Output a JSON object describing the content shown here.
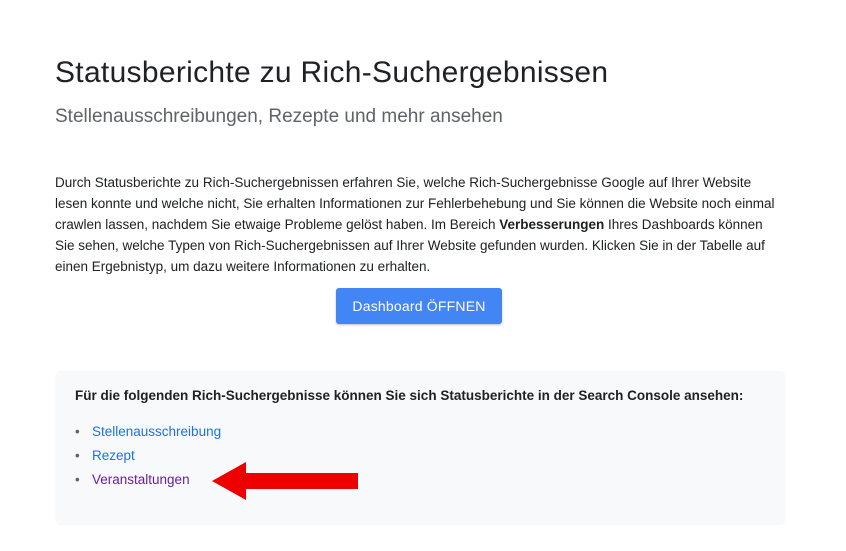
{
  "header": {
    "title": "Statusberichte zu Rich-Suchergebnissen",
    "subtitle": "Stellenausschreibungen, Rezepte und mehr ansehen"
  },
  "intro": {
    "text_before_bold": "Durch Statusberichte zu Rich-Suchergebnissen erfahren Sie, welche Rich-Suchergebnisse Google auf Ihrer Website lesen konnte und welche nicht, Sie erhalten Informationen zur Fehlerbehebung und Sie können die Website noch einmal crawlen lassen, nachdem Sie etwaige Probleme gelöst haben. Im Bereich ",
    "bold": "Verbesserungen",
    "text_after_bold": " Ihres Dashboards können Sie sehen, welche Typen von Rich-Suchergebnissen auf Ihrer Website gefunden wurden. Klicken Sie in der Tabelle auf einen Ergebnistyp, um dazu weitere Informationen zu erhalten."
  },
  "cta": {
    "label": "Dashboard ÖFFNEN"
  },
  "panel": {
    "heading": "Für die folgenden Rich-Suchergebnisse können Sie sich Statusberichte in der Search Console ansehen:",
    "bullet": "•",
    "items": [
      {
        "label": "Stellenausschreibung"
      },
      {
        "label": "Rezept"
      },
      {
        "label": "Veranstaltungen"
      }
    ]
  },
  "annotation": {
    "arrow_color": "#ee0000",
    "icon": "left-arrow-icon"
  },
  "colors": {
    "accent": "#4285f4",
    "link": "#1a73e8",
    "visited_link": "#681da8",
    "panel_background": "#f8f9fa"
  }
}
